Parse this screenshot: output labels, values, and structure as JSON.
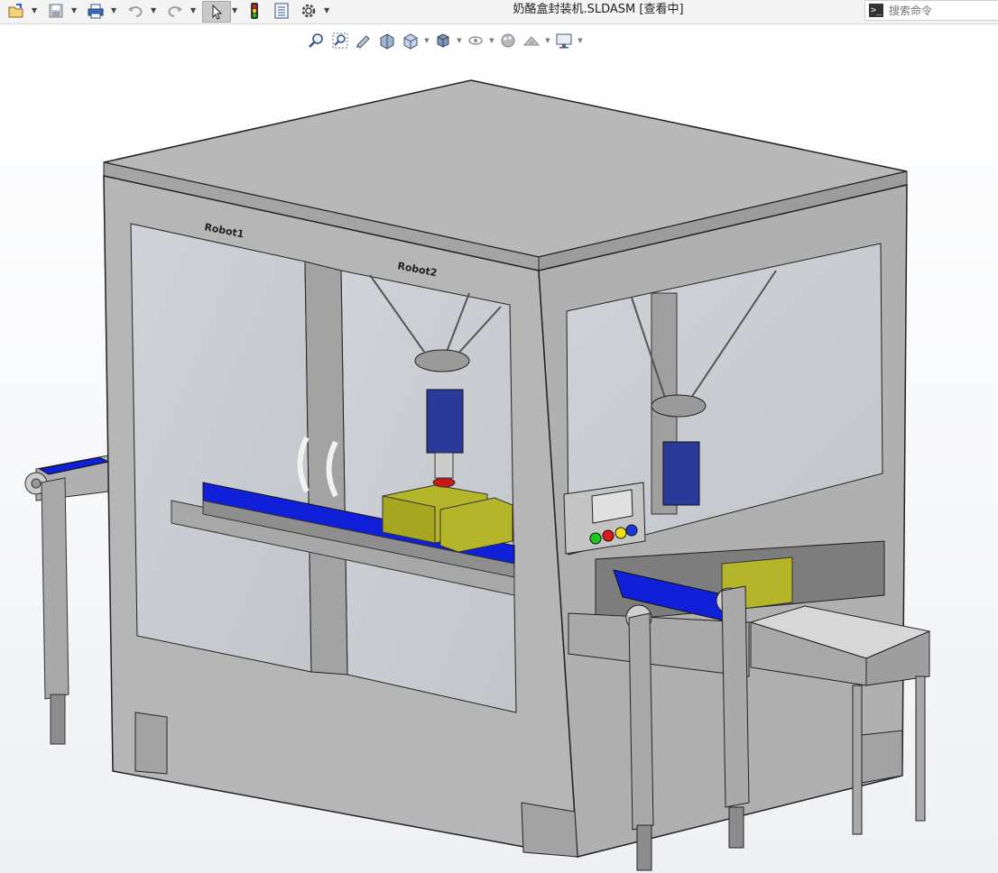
{
  "window": {
    "title": "奶酪盒封装机.SLDASM [查看中]"
  },
  "search": {
    "placeholder": "搜索命令"
  },
  "toolbar": {
    "icons": [
      "open-icon",
      "save-icon",
      "print-icon",
      "undo-icon",
      "redo-icon",
      "select-icon",
      "rebuild-icon",
      "file-properties-icon",
      "options-icon"
    ]
  },
  "heads_up_toolbar": {
    "icons": [
      "zoom-to-fit-icon",
      "zoom-to-area-icon",
      "previous-view-icon",
      "section-view-icon",
      "view-orientation-icon",
      "display-style-icon",
      "hide-show-items-icon",
      "edit-appearance-icon",
      "apply-scene-icon",
      "view-settings-icon"
    ]
  },
  "model": {
    "label_robot1": "Robot1",
    "label_robot2": "Robot2"
  },
  "colors": {
    "frame": "#b4b4b4",
    "frame_dark": "#8d8d8d",
    "roof": "#b8b8b8",
    "belt": "#1020d8",
    "cheese_box": "#b5b52a",
    "robot_arm": "#2b3a9a",
    "button_green": "#1ec81e",
    "button_red": "#e01818",
    "button_yellow": "#f0e010",
    "button_blue": "#1838e0"
  }
}
